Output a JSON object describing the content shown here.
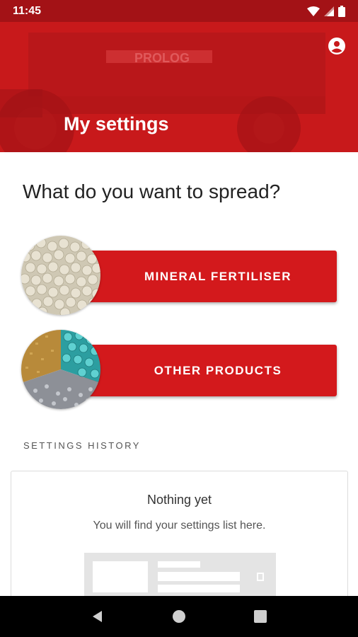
{
  "status_bar": {
    "time": "11:45",
    "icons": [
      "wifi-icon",
      "signal-icon",
      "battery-icon"
    ]
  },
  "header": {
    "title": "My settings",
    "account_icon": "account-circle-icon",
    "background_color": "#c8191b"
  },
  "main": {
    "question": "What do you want to spread?",
    "choices": [
      {
        "label": "MINERAL FERTILISER",
        "image": "fertiliser-granules-image"
      },
      {
        "label": "OTHER PRODUCTS",
        "image": "other-products-image"
      }
    ],
    "accent_color": "#d3191c"
  },
  "history": {
    "section_label": "SETTINGS HISTORY",
    "empty_title": "Nothing yet",
    "empty_description": "You will find your settings list here."
  },
  "nav_bar": {
    "icons": [
      "back-icon",
      "home-icon",
      "recents-icon"
    ]
  }
}
